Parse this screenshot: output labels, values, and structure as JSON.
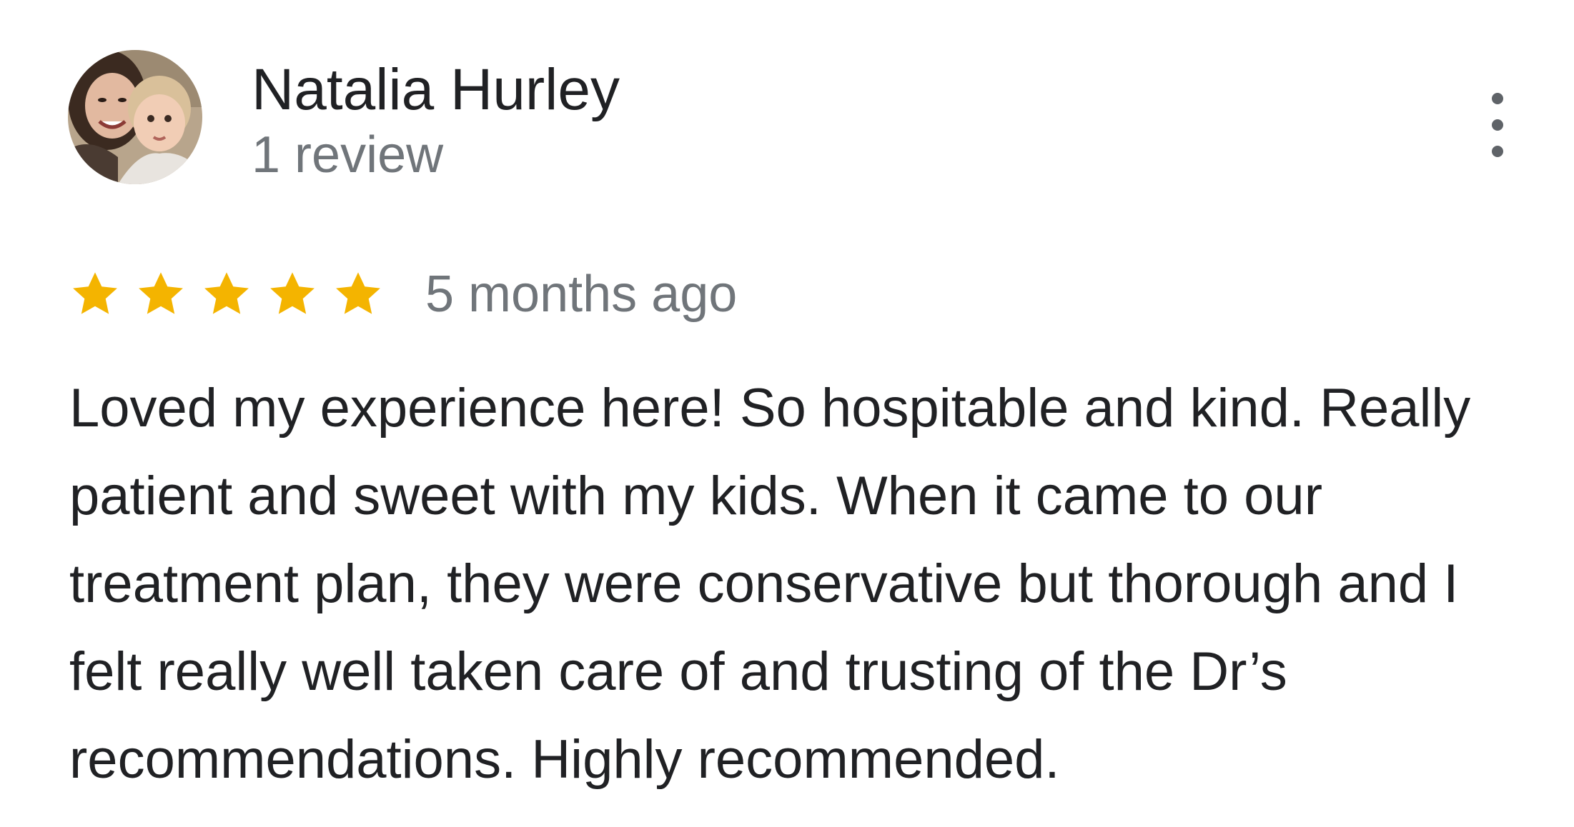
{
  "reviewer": {
    "name": "Natalia Hurley",
    "review_count": "1 review"
  },
  "avatar": {
    "icon": "profile-photo"
  },
  "menu": {
    "icon": "more-vert-icon"
  },
  "rating": {
    "stars": 5,
    "max_stars": 5,
    "star_color": "#f4b400",
    "time": "5 months ago"
  },
  "review": {
    "text": "Loved my experience here! So hospitable and kind. Really patient and sweet with my kids. When it came to our treatment plan, they were conservative but thorough and I felt really well taken care of and trusting of the Dr’s recommendations. Highly recommended."
  },
  "colors": {
    "primary_text": "#202124",
    "secondary_text": "#70757a",
    "icon": "#5f6368"
  }
}
